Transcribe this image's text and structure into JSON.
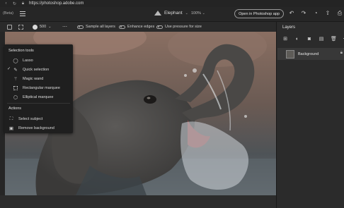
{
  "browser": {
    "url": "https://photoshop.adobe.com",
    "back_icon": "back-arrow-icon",
    "reload_icon": "reload-icon",
    "lock_icon": "lock-icon"
  },
  "header": {
    "beta_label": "(Beta)",
    "doc_title": "Elephant",
    "zoom": "100%",
    "open_button": "Open in Photoshop app",
    "icons": [
      "undo-icon",
      "redo-icon",
      "account-icon",
      "share-icon",
      "export-icon"
    ]
  },
  "options": {
    "brush_size": "500",
    "sample_all_layers": "Sample all layers",
    "enhance_edges": "Enhance edges",
    "use_pressure": "Use pressure for size"
  },
  "selection_popup": {
    "title": "Selection tools",
    "tools": [
      {
        "label": "Lasso",
        "icon": "lasso-icon",
        "selected": false
      },
      {
        "label": "Quick selection",
        "icon": "quick-selection-icon",
        "selected": true
      },
      {
        "label": "Magic wand",
        "icon": "magic-wand-icon",
        "selected": false
      },
      {
        "label": "Rectangular marquee",
        "icon": "rect-marquee-icon",
        "selected": false
      },
      {
        "label": "Elliptical marquee",
        "icon": "ellipse-marquee-icon",
        "selected": false
      }
    ],
    "actions_title": "Actions",
    "actions": [
      {
        "label": "Select subject",
        "icon": "select-subject-icon"
      },
      {
        "label": "Remove background",
        "icon": "remove-background-icon"
      }
    ]
  },
  "layers_panel": {
    "title": "Layers",
    "toolbar_icons": [
      "add-layer-icon",
      "adjustment-icon",
      "mask-icon",
      "group-icon",
      "delete-icon",
      "more-icon"
    ],
    "layers": [
      {
        "name": "Background",
        "locked": true
      }
    ]
  },
  "colors": {
    "app_bg": "#1e1e1e",
    "panel_bg": "#2b2b2b",
    "popup_bg": "#1f1f1f",
    "selected_layer": "#383838"
  }
}
